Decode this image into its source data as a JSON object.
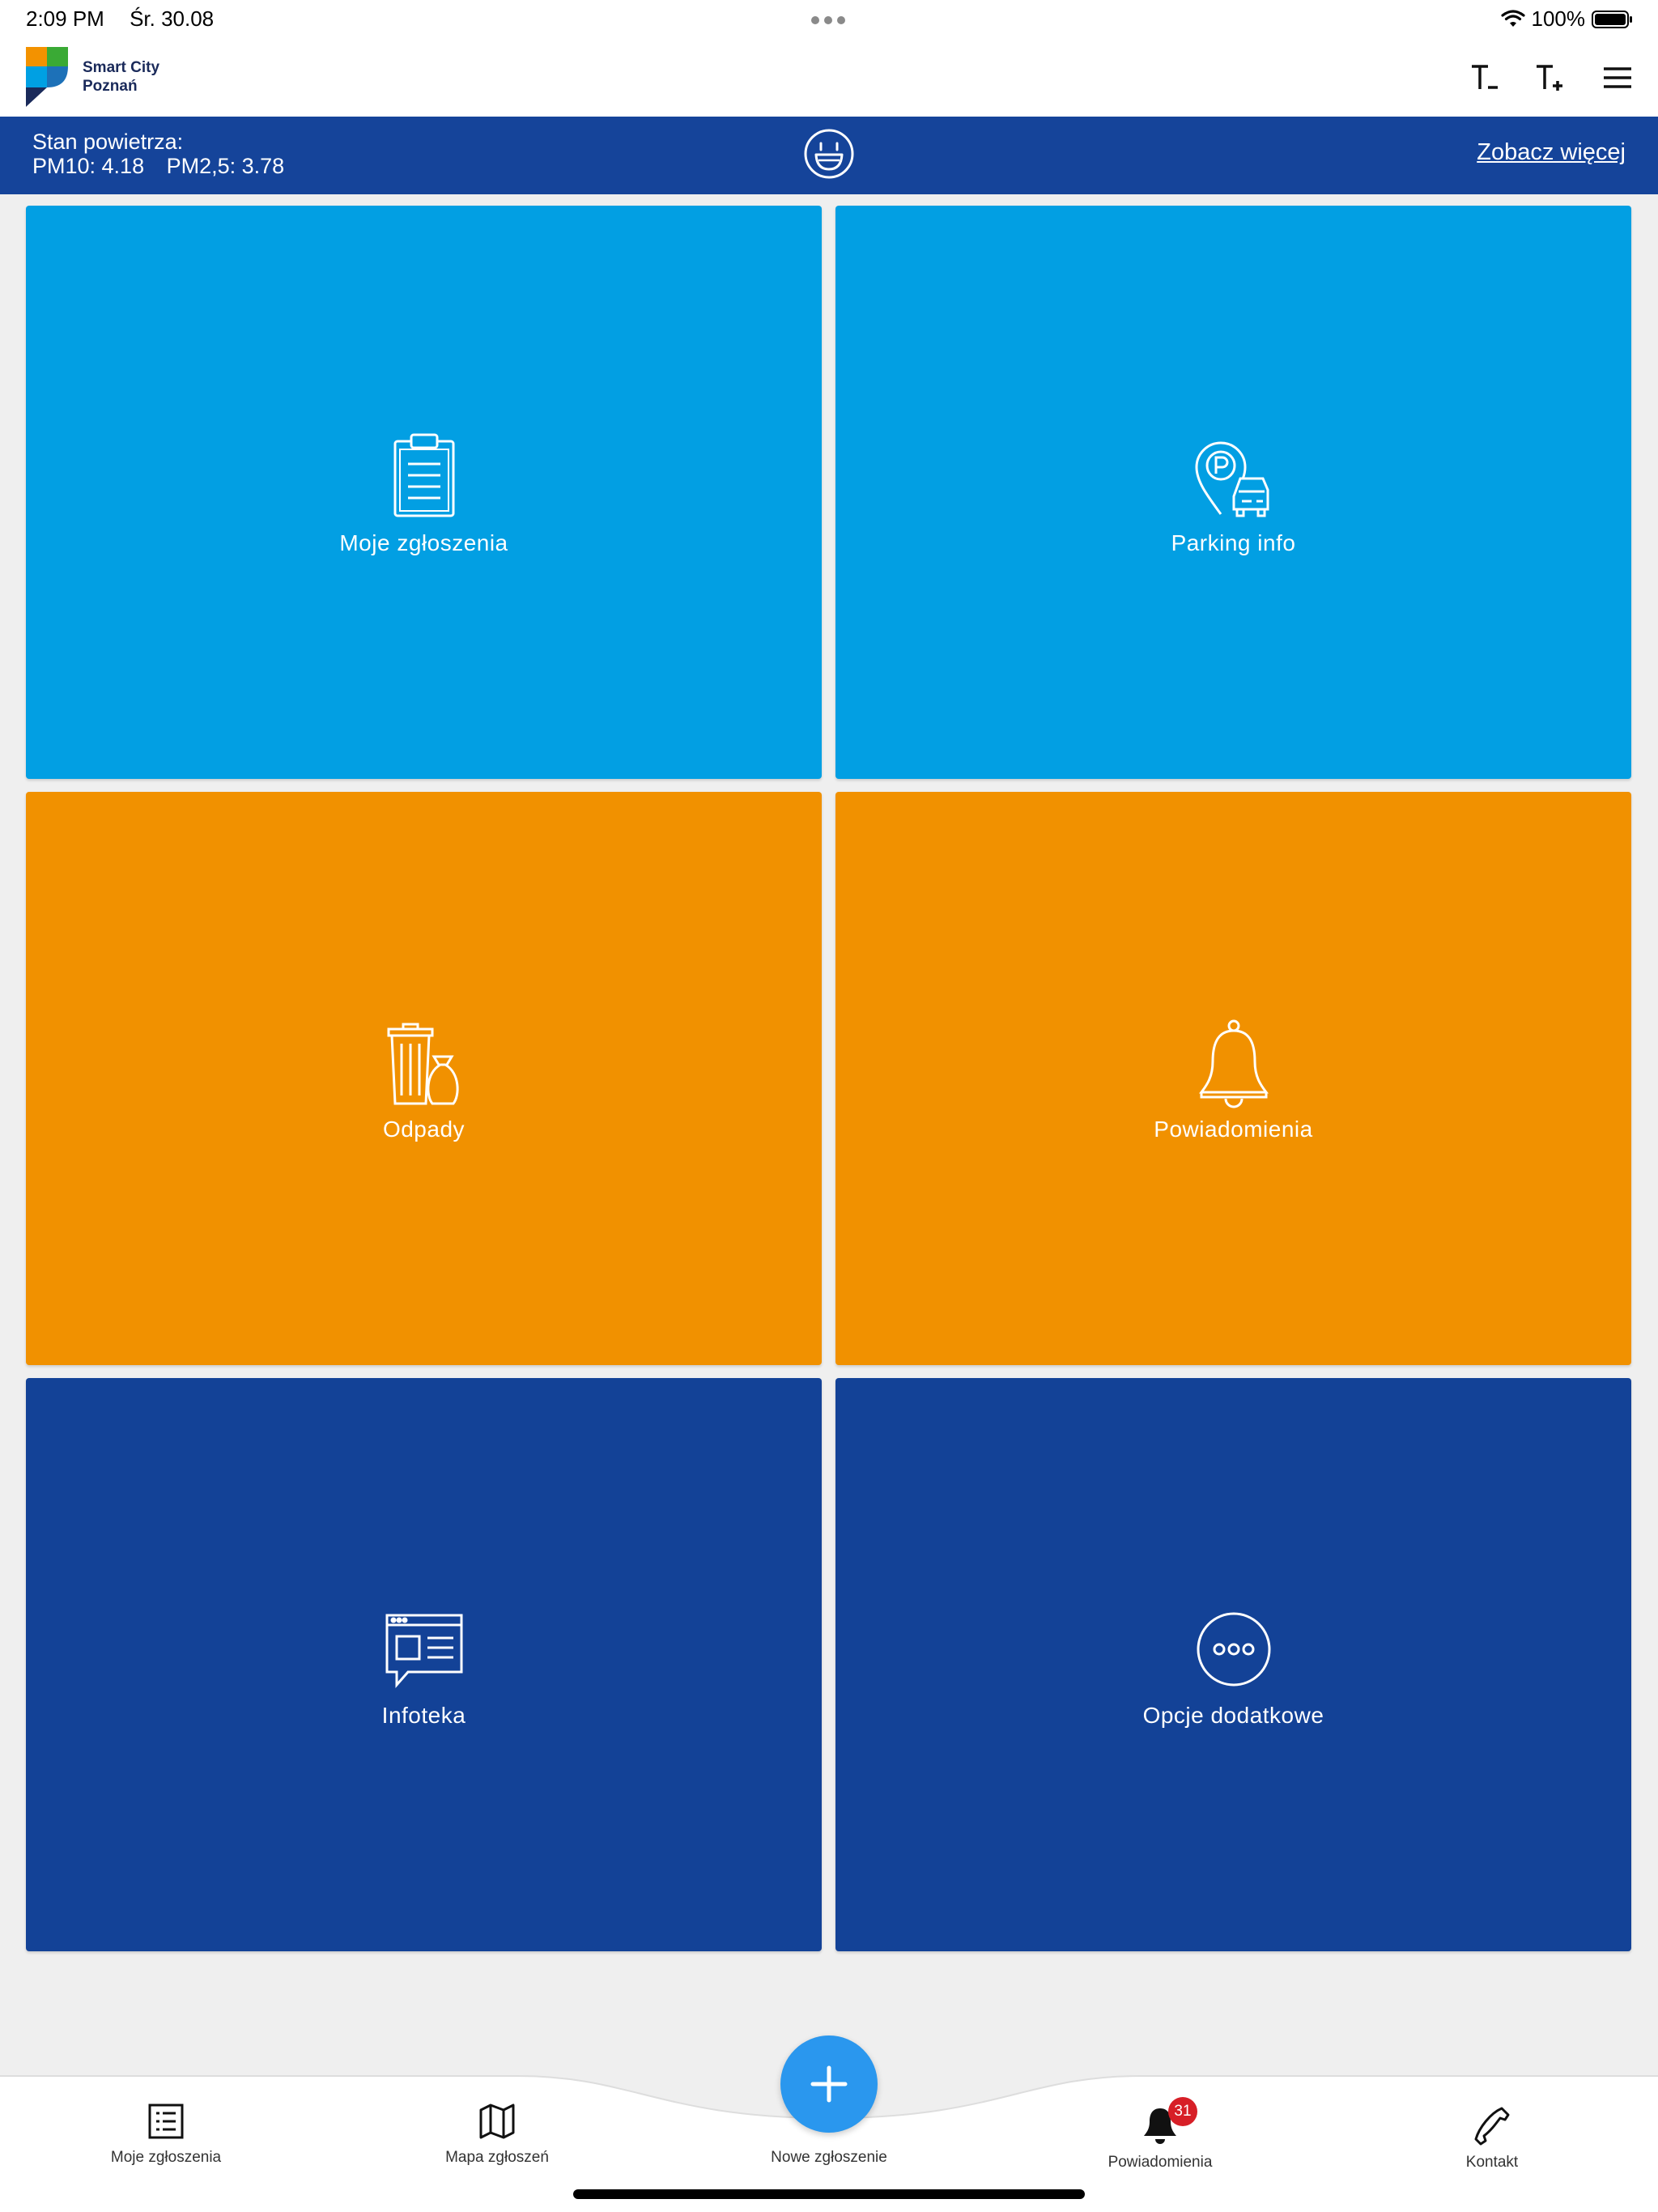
{
  "status_bar": {
    "time": "2:09 PM",
    "date": "Śr. 30.08",
    "battery": "100%"
  },
  "header": {
    "logo_line1": "Smart City",
    "logo_line2": "Poznań",
    "icons": [
      "text-decrease-icon",
      "text-increase-icon",
      "menu-icon"
    ]
  },
  "air": {
    "title": "Stan powietrza:",
    "pm10": "PM10: 4.18",
    "pm25": "PM2,5: 3.78",
    "more_link": "Zobacz więcej",
    "face_icon": "smiley-face-icon"
  },
  "tiles": [
    {
      "label": "Moje zgłoszenia",
      "icon": "clipboard-icon"
    },
    {
      "label": "Parking info",
      "icon": "parking-car-icon"
    },
    {
      "label": "Odpady",
      "icon": "trash-bin-icon"
    },
    {
      "label": "Powiadomienia",
      "icon": "bell-icon"
    },
    {
      "label": "Infoteka",
      "icon": "news-chat-icon"
    },
    {
      "label": "Opcje dodatkowe",
      "icon": "more-options-icon"
    }
  ],
  "colors": {
    "tile_blue": "#029fe3",
    "tile_orange": "#f19100",
    "tile_navy": "#134297",
    "air_bar": "#15449a",
    "fab": "#2a97ee",
    "badge": "#d71f27"
  },
  "bottom_nav": {
    "items": [
      {
        "label": "Moje zgłoszenia",
        "icon": "list-icon"
      },
      {
        "label": "Mapa zgłoszeń",
        "icon": "map-icon"
      },
      {
        "label": "Nowe zgłoszenie",
        "icon": "plus-icon"
      },
      {
        "label": "Powiadomienia",
        "icon": "bell-icon",
        "badge": "31"
      },
      {
        "label": "Kontakt",
        "icon": "phone-icon"
      }
    ]
  }
}
